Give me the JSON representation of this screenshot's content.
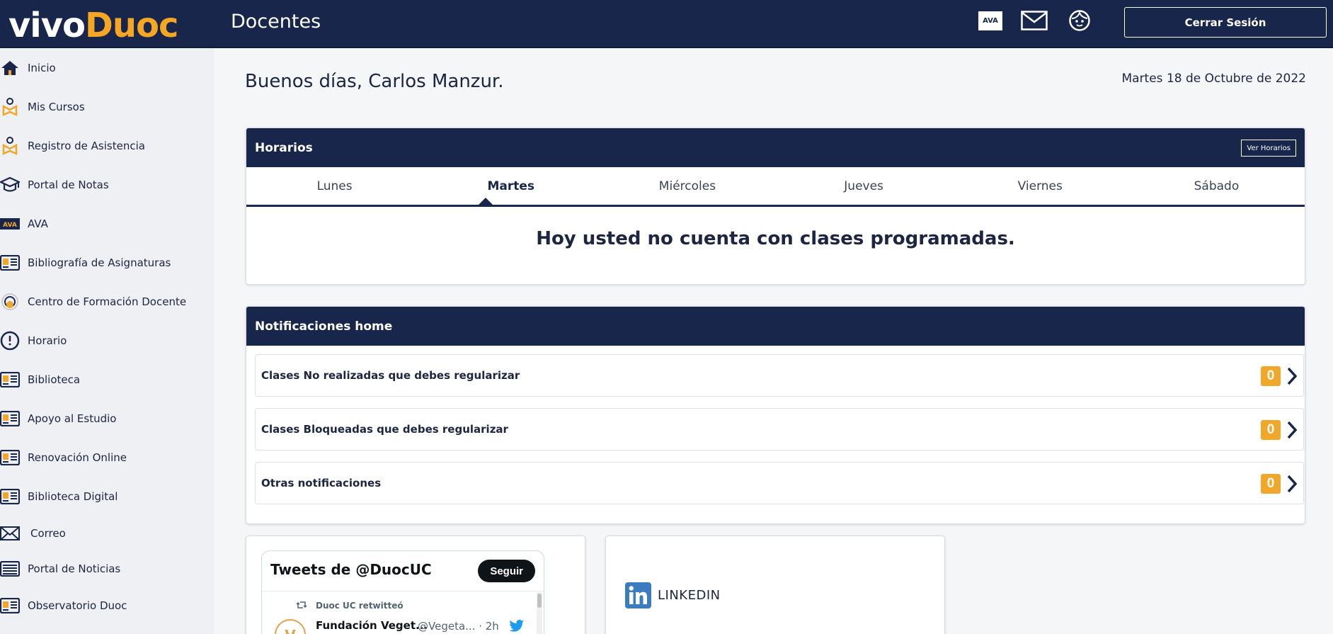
{
  "header": {
    "logo_part1": "vivo",
    "logo_part2": "Duoc",
    "title": "Docentes",
    "ava_label": "AVA",
    "logout_label": "Cerrar Sesión"
  },
  "sidebar": {
    "items": [
      {
        "label": "Inicio",
        "icon": "home-icon"
      },
      {
        "label": "Mis Cursos",
        "icon": "cursos-icon"
      },
      {
        "label": "Registro de Asistencia",
        "icon": "asistencia-icon"
      },
      {
        "label": "Portal de Notas",
        "icon": "graduation-cap-icon"
      },
      {
        "label": "AVA",
        "icon": "ava-icon"
      },
      {
        "label": "Bibliografía de Asignaturas",
        "icon": "book-icon"
      },
      {
        "label": "Centro de Formación Docente",
        "icon": "formacion-icon"
      },
      {
        "label": "Horario",
        "icon": "clock-icon"
      },
      {
        "label": "Biblioteca",
        "icon": "book-icon"
      },
      {
        "label": "Apoyo al Estudio",
        "icon": "book-icon"
      },
      {
        "label": "Renovación Online",
        "icon": "book-icon"
      },
      {
        "label": "Biblioteca Digital",
        "icon": "book-icon"
      },
      {
        "label": "Correo",
        "icon": "mail-icon"
      },
      {
        "label": "Portal de Noticias",
        "icon": "news-icon"
      },
      {
        "label": "Observatorio Duoc",
        "icon": "book-icon"
      }
    ]
  },
  "main": {
    "greeting": "Buenos días, Carlos Manzur.",
    "date": "Martes 18 de Octubre de 2022",
    "horarios": {
      "title": "Horarios",
      "ver_label": "Ver Horarios",
      "tabs": [
        "Lunes",
        "Martes",
        "Miércoles",
        "Jueves",
        "Viernes",
        "Sábado"
      ],
      "active_tab": "Martes",
      "empty_message": "Hoy usted no cuenta con clases programadas."
    },
    "notificaciones": {
      "title": "Notificaciones home",
      "rows": [
        {
          "label": "Clases No realizadas que debes regularizar",
          "count": "0"
        },
        {
          "label": "Clases Bloqueadas que debes regularizar",
          "count": "0"
        },
        {
          "label": "Otras notificaciones",
          "count": "0"
        }
      ]
    },
    "twitter": {
      "title": "Tweets de @DuocUC",
      "follow_label": "Seguir",
      "retweet_text": "Duoc UC retwitteó",
      "tweet_name": "Fundación Veget...",
      "tweet_handle": "@Vegeta... · 2h"
    },
    "linkedin": {
      "label": "LINKEDIN"
    }
  },
  "colors": {
    "navy": "#17264a",
    "accent": "#f0a72a",
    "background": "#f5f6f8"
  }
}
